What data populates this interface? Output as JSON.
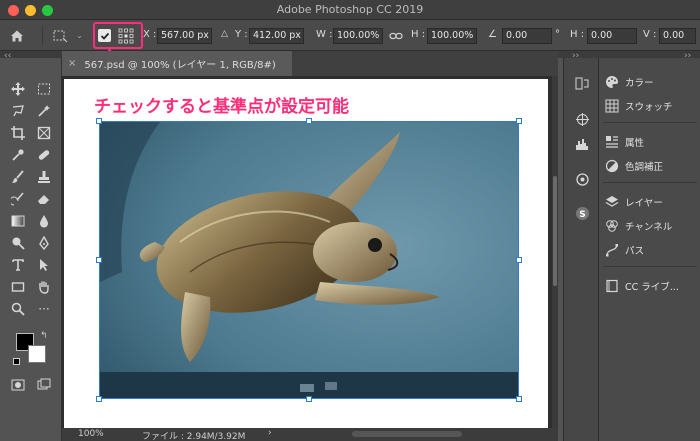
{
  "window": {
    "title": "Adobe Photoshop CC 2019"
  },
  "options_bar": {
    "x_label": "X :",
    "x_value": "567.00 px",
    "y_label": "Y :",
    "y_value": "412.00 px",
    "w_label": "W :",
    "w_value": "100.00%",
    "h_label": "H :",
    "h_value": "100.00%",
    "angle_value": "0.00",
    "angle_unit": "°",
    "hskew_label": "H :",
    "hskew_value": "0.00",
    "vskew_value": "0.00"
  },
  "document": {
    "tab_label": "567.psd @ 100% (レイヤー 1, RGB/8#)"
  },
  "status": {
    "zoom": "100%",
    "file_info": "ファイル : 2.94M/3.92M",
    "arrow": "›"
  },
  "panels": {
    "color": "カラー",
    "swatches": "スウォッチ",
    "properties": "属性",
    "adjustments": "色調補正",
    "layers": "レイヤー",
    "channels": "チャンネル",
    "paths": "パス",
    "libraries": "CC ライブ..."
  },
  "annotation": {
    "text": "チェックすると基準点が設定可能",
    "color": "#ff2d7a"
  },
  "colors": {
    "accent": "#ff2d7a",
    "selection": "#2f7bd1"
  }
}
